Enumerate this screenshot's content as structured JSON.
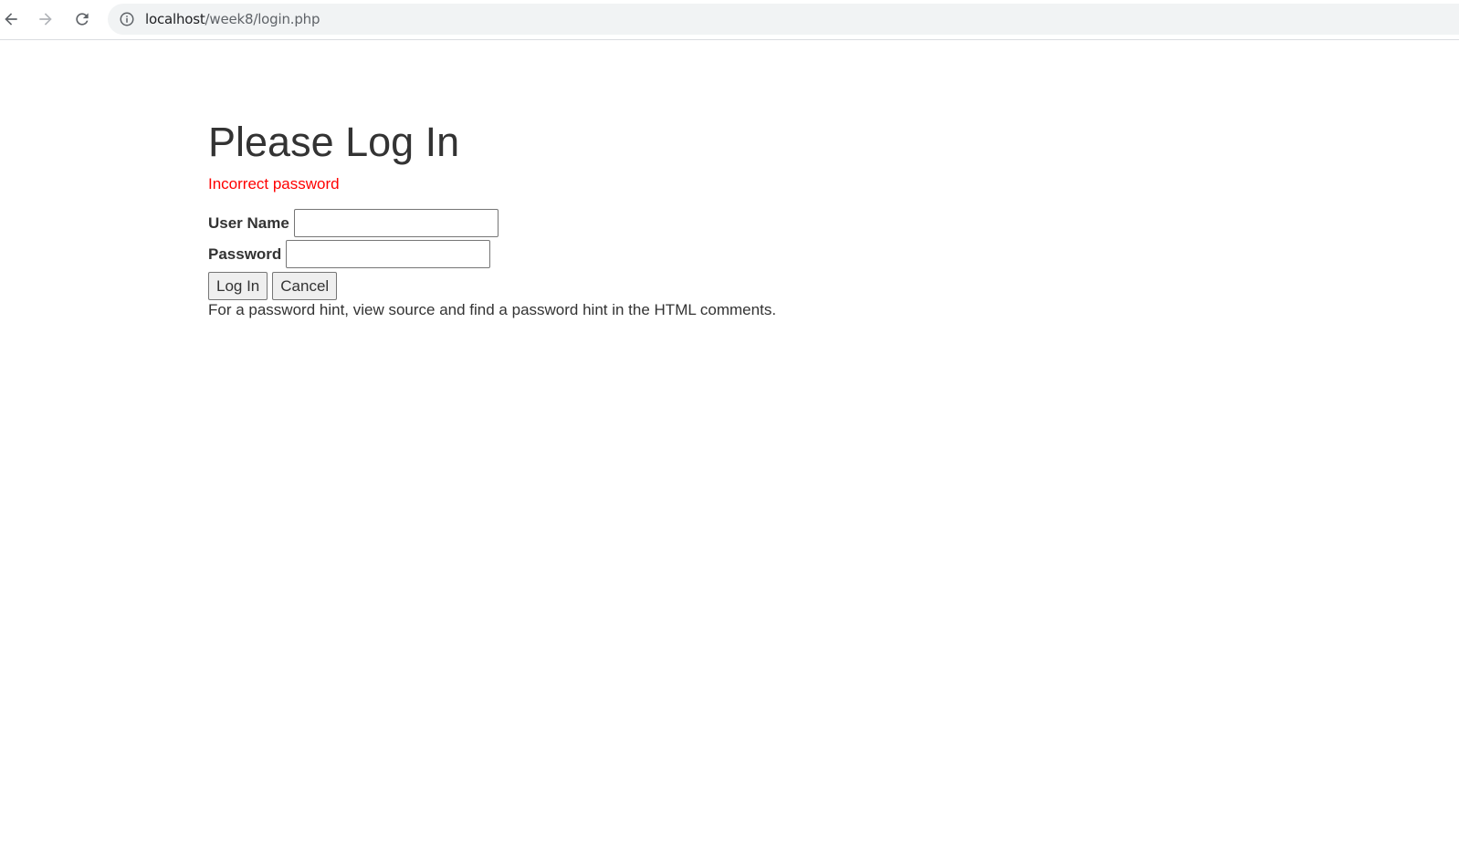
{
  "browser": {
    "url_host": "localhost",
    "url_path": "/week8/login.php"
  },
  "page": {
    "title": "Please Log In",
    "error": "Incorrect password",
    "username_label": "User Name",
    "username_value": "",
    "password_label": "Password",
    "password_value": "",
    "login_button": "Log In",
    "cancel_button": "Cancel",
    "hint": "For a password hint, view source and find a password hint in the HTML comments."
  },
  "colors": {
    "error": "#ff0000",
    "text": "#333333",
    "omnibox": "#f1f3f4"
  }
}
